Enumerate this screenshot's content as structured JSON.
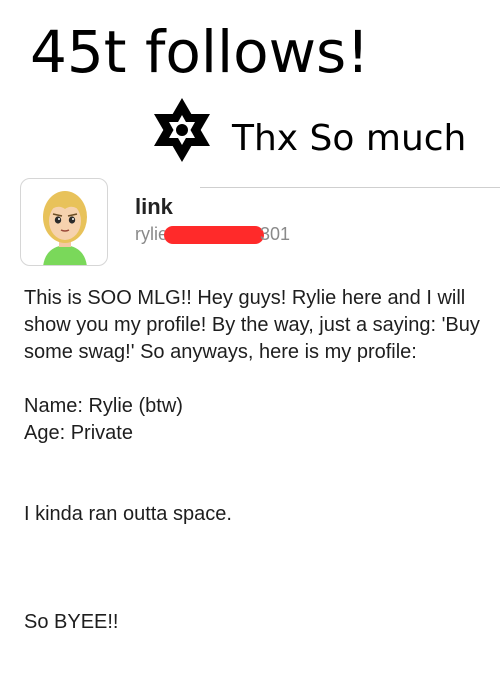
{
  "header_note": {
    "line1": "45t follows!",
    "line2": "Thx So much"
  },
  "icons": {
    "star": "star-of-david-icon",
    "avatar": "mii-avatar"
  },
  "profile": {
    "display_name": "link",
    "username_prefix": "rylie",
    "username_suffix": "301"
  },
  "post": {
    "intro": "This is SOO MLG!! Hey guys! Rylie here and I will show you my profile! By the way, just a saying: 'Buy some swag!' So anyways, here is my profile:",
    "name_line": "Name: Rylie (btw)",
    "age_line": "Age: Private",
    "space_line": "I kinda ran outta space.",
    "bye_line": "So BYEE!!"
  }
}
